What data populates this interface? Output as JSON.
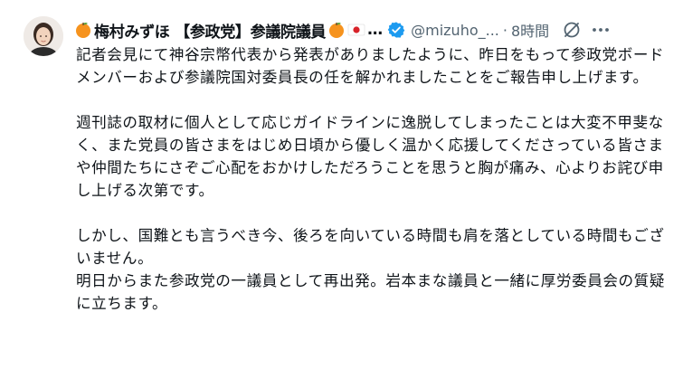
{
  "tweet": {
    "display_name": "梅村みずほ 【参政党】参議院議員",
    "name_ellipsis": "…",
    "handle": "@mizuho_...",
    "separator": "·",
    "timestamp": "8時間",
    "icons": {
      "orange": "orange-emoji-icon",
      "flag": "japan-flag-icon",
      "verified": "verified-badge-icon",
      "grok": "grok-icon",
      "more": "more-options-icon"
    },
    "colors": {
      "text": "#0f1419",
      "secondary": "#536471",
      "verified": "#1d9bf0"
    },
    "body": {
      "p1": "記者会見にて神谷宗幣代表から発表がありましたように、昨日をもって参政党ボードメンバーおよび参議院国対委員長の任を解かれましたことをご報告申し上げます。",
      "p2": "週刊誌の取材に個人として応じガイドラインに逸脱してしまったことは大変不甲斐なく、また党員の皆さまをはじめ日頃から優しく温かく応援してくださっている皆さまや仲間たちにさぞご心配をおかけしただろうことを思うと胸が痛み、心よりお詫び申し上げる次第です。",
      "p3": "しかし、国難とも言うべき今、後ろを向いている時間も肩を落としている時間もございません。",
      "p4": "明日からまた参政党の一議員として再出発。岩本まな議員と一緒に厚労委員会の質疑に立ちます。"
    }
  }
}
